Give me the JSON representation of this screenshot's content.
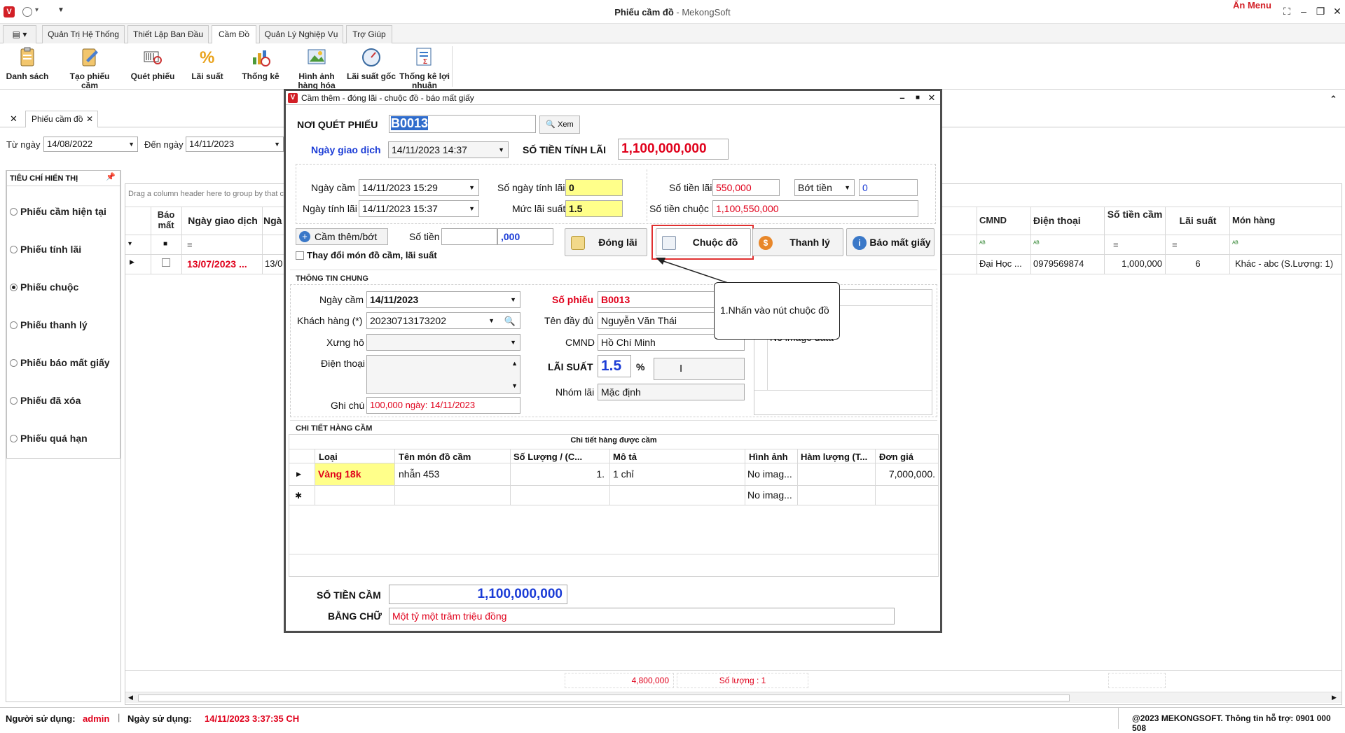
{
  "window": {
    "title": "Phiếu cầm đồ",
    "subtitle": "- MekongSoft",
    "an_menu": "Ẩn Menu"
  },
  "tabs": [
    {
      "label": "Quản Trị Hệ Thống"
    },
    {
      "label": "Thiết Lập Ban Đầu"
    },
    {
      "label": "Cầm Đồ"
    },
    {
      "label": "Quản Lý Nghiệp Vụ"
    },
    {
      "label": "Trợ Giúp"
    }
  ],
  "ribbon": [
    {
      "label": "Danh sách",
      "icon": "clipboard-icon"
    },
    {
      "label": "Tạo phiếu cầm",
      "icon": "edit-form-icon"
    },
    {
      "label": "Quét phiếu",
      "icon": "barcode-scan-icon"
    },
    {
      "label": "Lãi suất",
      "icon": "percent-icon"
    },
    {
      "label": "Thống kê",
      "icon": "chart-icon"
    },
    {
      "label": "Hình ảnh hàng hóa",
      "icon": "image-icon"
    },
    {
      "label": "Lãi suất gốc",
      "icon": "gauge-icon"
    },
    {
      "label": "Thống kê lợi nhuận",
      "icon": "report-icon"
    }
  ],
  "doc_tab": "Phiếu cầm đồ",
  "filter": {
    "from_label": "Từ ngày",
    "from_value": "14/08/2022",
    "to_label": "Đến ngày",
    "to_value": "14/11/2023"
  },
  "left_panel": {
    "title": "TIÊU CHÍ HIỂN THỊ",
    "options": [
      {
        "label": "Phiếu cầm hiện tại",
        "selected": false
      },
      {
        "label": "Phiếu tính lãi",
        "selected": false
      },
      {
        "label": "Phiếu chuộc",
        "selected": true
      },
      {
        "label": "Phiếu thanh lý",
        "selected": false
      },
      {
        "label": "Phiếu báo mất giấy",
        "selected": false
      },
      {
        "label": "Phiếu đã xóa",
        "selected": false
      },
      {
        "label": "Phiếu quá hạn",
        "selected": false
      }
    ]
  },
  "grid": {
    "group_hint": "Drag a column header here to group by that c",
    "headers_left": [
      "Báo mất",
      "Ngày giao dịch",
      "Ngà"
    ],
    "headers_right": [
      "CMND",
      "Điện thoại",
      "Số tiền cầm",
      "Lãi suất",
      "Món hàng"
    ],
    "row": {
      "date": "13/07/2023 ...",
      "date2": "13/0",
      "cmnd": "Đại Học ...",
      "phone": "0979569874",
      "amount": "1,000,000",
      "rate": "6",
      "item": "Khác - abc (S.Lượng: 1)"
    },
    "footer_sum": "4,800,000",
    "footer_count": "Số lượng : 1"
  },
  "dialog": {
    "title": "Cầm thêm - đóng lãi - chuộc đồ - báo mất giấy",
    "scan_label": "NƠI QUÉT PHIẾU",
    "scan_value": "B0013",
    "xem_label": "Xem",
    "tx_date_label": "Ngày giao dịch",
    "tx_date_value": "14/11/2023 14:37",
    "interest_amount_label": "SỐ TIỀN TÍNH LÃI",
    "interest_amount_value": "1,100,000,000",
    "pawn_date_label": "Ngày cầm",
    "pawn_date_value": "14/11/2023 15:29",
    "interest_date_label": "Ngày tính lãi",
    "interest_date_value": "14/11/2023 15:37",
    "days_label": "Số ngày tính lãi",
    "days_value": "0",
    "rate_label": "Mức lãi suất",
    "rate_value": "1.5",
    "interest_label": "Số tiền lãi",
    "interest_value": "550,000",
    "bot_tien_label": "Bớt tiền",
    "bot_tien_value": "0",
    "redeem_label": "Số tiền chuộc",
    "redeem_value": "1,100,550,000",
    "cam_them_label": "Cầm thêm/bớt",
    "so_tien_label": "Số tiền",
    "so_tien_value": ",000",
    "change_checkbox_label": "Thay đổi món đồ cầm, lãi suất",
    "btn_dong_lai": "Đóng lãi",
    "btn_chuoc_do": "Chuộc đồ",
    "btn_thanh_ly": "Thanh lý",
    "btn_bao_mat": "Báo mất giấy",
    "section_general": "THÔNG TIN CHUNG",
    "g_pawn_date_label": "Ngày cầm",
    "g_pawn_date_value": "14/11/2023",
    "customer_label": "Khách hàng (*)",
    "customer_value": "20230713173202",
    "xung_ho_label": "Xưng hô",
    "phone_label": "Điện thoại",
    "note_label": "Ghi chú",
    "note_value": "100,000 ngày: 14/11/2023",
    "so_phieu_label": "Số phiếu",
    "so_phieu_value": "B0013",
    "full_name_label": "Tên đầy đủ",
    "full_name_value": "Nguyễn Văn Thái",
    "cmnd_label": "CMND",
    "cmnd_value": "Hồ Chí Minh",
    "lai_suat_label": "LÃI SUẤT",
    "lai_suat_value": "1.5",
    "percent": "%",
    "nhom_lai_label": "Nhóm lãi",
    "nhom_lai_value": "Mặc định",
    "no_image": "No image data",
    "section_detail": "CHI TIẾT HÀNG CẦM",
    "detail_caption": "Chi tiết hàng được cầm",
    "detail_headers": [
      "Loại",
      "Tên món đồ cầm",
      "Số Lượng / (C...",
      "Mô tả",
      "Hình ảnh",
      "Hàm lượng (T...",
      "Đơn giá"
    ],
    "detail_row": {
      "loai": "Vàng 18k",
      "ten": "nhẫn 453",
      "sl": "1.",
      "mota": "1 chỉ",
      "hinh": "No imag...",
      "dongia": "7,000,000."
    },
    "detail_new_row_image": "No imag...",
    "total_label": "SỐ TIỀN CẦM",
    "total_value": "1,100,000,000",
    "words_label": "BẰNG CHỮ",
    "words_value": "Một tỷ một trăm triệu đồng"
  },
  "callout": "1.Nhấn vào nút chuộc đồ",
  "status": {
    "user_label": "Người sử dụng:",
    "user_value": "admin",
    "date_label": "Ngày sử dụng:",
    "date_value": "14/11/2023 3:37:35 CH",
    "copyright": "@2023 MEKONGSOFT. Thông tin hỗ trợ: 0901 000 508"
  },
  "colors": {
    "accent_red": "#e0001b",
    "blue": "#1b3cd6",
    "highlight_yellow": "#ffff8a"
  }
}
